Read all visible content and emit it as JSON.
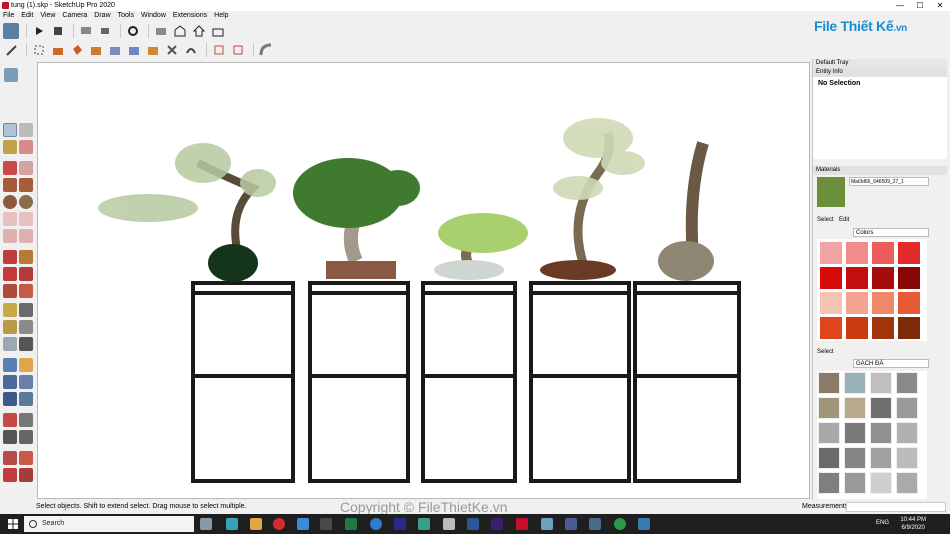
{
  "window": {
    "title": "tung (1).skp - SketchUp Pro 2020",
    "controls": [
      "—",
      "☐",
      "✕"
    ]
  },
  "menu": [
    "File",
    "Edit",
    "View",
    "Camera",
    "Draw",
    "Tools",
    "Window",
    "Extensions",
    "Help"
  ],
  "logo": {
    "text": "File Thiết Kế",
    "suffix": ".vn"
  },
  "tray": {
    "title": "Default Tray",
    "entity_info": {
      "header": "Entity Info",
      "selection": "No Selection"
    },
    "materials": {
      "header": "Materials",
      "material_name": "Mat3d66_646509_27_1",
      "tabs": [
        "Select",
        "Edit"
      ],
      "collection": "Colors",
      "swatch_colors": [
        "#f2a3a3",
        "#f28b8b",
        "#ee5b5b",
        "#e12b2b",
        "#d80b0b",
        "#c40d0d",
        "#a50c0c",
        "#8a0707",
        "#f5c4b5",
        "#f3a592",
        "#ef8868",
        "#e65b35",
        "#e0451b",
        "#ca3c10",
        "#a0350c",
        "#7c2a08"
      ],
      "secondary_label": "Select",
      "secondary_collection": "GẠCH ĐÁ"
    }
  },
  "status": {
    "message": "Select objects. Shift to extend select. Drag mouse to select multiple.",
    "measurements_label": "Measurements"
  },
  "watermark": "Copyright © FileThietKe.vn",
  "taskbar": {
    "search_placeholder": "Search",
    "lang": "ENG",
    "time": "10:44 PM",
    "date": "6/9/2020"
  }
}
